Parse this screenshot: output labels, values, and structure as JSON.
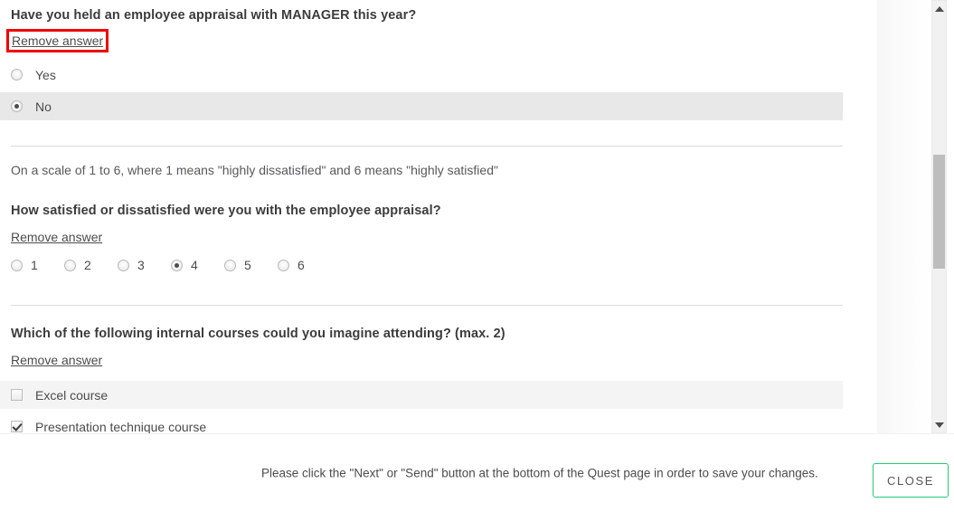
{
  "questions": [
    {
      "id": "appraisal-held",
      "title": "Have you held an employee appraisal with MANAGER this year?",
      "remove_label": "Remove answer",
      "remove_highlighted": true,
      "type": "radio",
      "options": [
        {
          "label": "Yes",
          "checked": false,
          "shade": "none"
        },
        {
          "label": "No",
          "checked": true,
          "shade": "dark"
        }
      ]
    },
    {
      "id": "appraisal-satisfaction",
      "intro": "On a scale of 1 to 6, where 1 means \"highly dissatisfied\" and 6 means \"highly satisfied\"",
      "title": "How satisfied or dissatisfied were you with the employee appraisal?",
      "remove_label": "Remove answer",
      "remove_highlighted": false,
      "type": "scale",
      "options": [
        {
          "label": "1",
          "checked": false
        },
        {
          "label": "2",
          "checked": false
        },
        {
          "label": "3",
          "checked": false
        },
        {
          "label": "4",
          "checked": true
        },
        {
          "label": "5",
          "checked": false
        },
        {
          "label": "6",
          "checked": false
        }
      ]
    },
    {
      "id": "internal-courses",
      "title": "Which of the following internal courses could you imagine attending? (max. 2)",
      "remove_label": "Remove answer",
      "remove_highlighted": false,
      "type": "checkbox",
      "options": [
        {
          "label": "Excel course",
          "checked": false,
          "shade": "light"
        },
        {
          "label": "Presentation technique course",
          "checked": true,
          "shade": "none"
        },
        {
          "label": "",
          "checked": false,
          "shade": "light"
        }
      ]
    }
  ],
  "scrollbar": {
    "up_arrow": "scroll-up-arrow",
    "down_arrow": "scroll-down-arrow"
  },
  "footer": {
    "note": "Please click the \"Next\" or \"Send\" button at the bottom of the Quest page in order to save your changes.",
    "close_label": "CLOSE"
  },
  "colors": {
    "highlight": "#f00000",
    "close_border": "#22cc74",
    "row_shade_dark": "#e8e8e8",
    "row_shade_light": "#f4f4f4",
    "divider": "#dcdcdc"
  }
}
